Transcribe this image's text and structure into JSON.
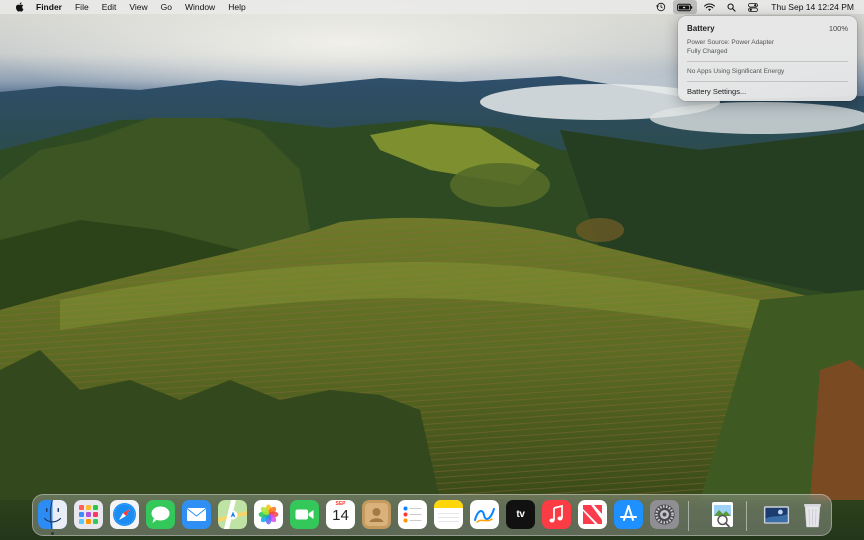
{
  "menubar": {
    "app_name": "Finder",
    "menus": [
      "File",
      "Edit",
      "View",
      "Go",
      "Window",
      "Help"
    ],
    "clock": "Thu Sep 14  12:24 PM",
    "status_icons": [
      "time-machine-icon",
      "battery-icon",
      "wifi-icon",
      "search-icon",
      "control-center-icon"
    ]
  },
  "battery_popover": {
    "title": "Battery",
    "percent": "100%",
    "power_source": "Power Source: Power Adapter",
    "charge_state": "Fully Charged",
    "energy_note": "No Apps Using Significant Energy",
    "settings_label": "Battery Settings..."
  },
  "dock": {
    "apps": [
      {
        "name": "Finder",
        "icon": "finder-icon",
        "running": true
      },
      {
        "name": "Launchpad",
        "icon": "launchpad-icon",
        "running": false
      },
      {
        "name": "Safari",
        "icon": "safari-icon",
        "running": false
      },
      {
        "name": "Messages",
        "icon": "messages-icon",
        "running": false
      },
      {
        "name": "Mail",
        "icon": "mail-icon",
        "running": false
      },
      {
        "name": "Maps",
        "icon": "maps-icon",
        "running": false
      },
      {
        "name": "Photos",
        "icon": "photos-icon",
        "running": false
      },
      {
        "name": "FaceTime",
        "icon": "facetime-icon",
        "running": false
      },
      {
        "name": "Calendar",
        "icon": "calendar-icon",
        "running": false
      },
      {
        "name": "Contacts",
        "icon": "contacts-icon",
        "running": false
      },
      {
        "name": "Reminders",
        "icon": "reminders-icon",
        "running": false
      },
      {
        "name": "Notes",
        "icon": "notes-icon",
        "running": false
      },
      {
        "name": "Freeform",
        "icon": "freeform-icon",
        "running": false
      },
      {
        "name": "TV",
        "icon": "tv-icon",
        "running": false
      },
      {
        "name": "Music",
        "icon": "music-icon",
        "running": false
      },
      {
        "name": "News",
        "icon": "news-icon",
        "running": false
      },
      {
        "name": "App Store",
        "icon": "app-store-icon",
        "running": false
      },
      {
        "name": "System Settings",
        "icon": "system-settings-icon",
        "running": false
      },
      {
        "name": "Preview",
        "icon": "preview-icon",
        "running": false
      },
      {
        "name": "Downloads",
        "icon": "downloads-stack-icon",
        "running": false
      },
      {
        "name": "Trash",
        "icon": "trash-icon",
        "running": false
      }
    ],
    "calendar_month": "SEP",
    "calendar_day": "14",
    "tv_label": "tv"
  },
  "colors": {
    "accent": "#0a84ff",
    "messages_green": "#34c759",
    "music_red": "#fc3c44",
    "calendar_red": "#ff3b30"
  }
}
